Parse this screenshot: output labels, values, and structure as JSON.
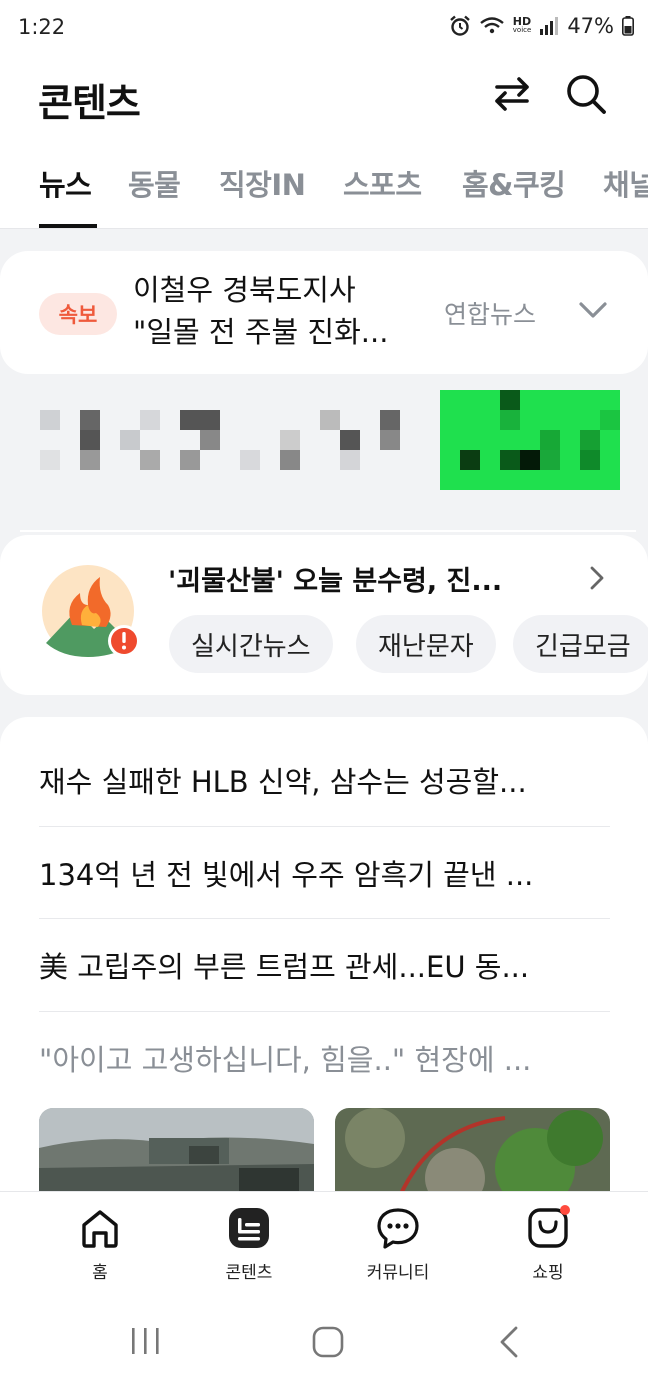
{
  "status_bar": {
    "time": "1:22",
    "hd_label": "HD",
    "voice_label": "voice",
    "battery": "47%"
  },
  "header": {
    "title": "콘텐츠",
    "swap_icon": "swap-arrows-icon",
    "search_icon": "search-icon"
  },
  "tabs": [
    {
      "label": "뉴스",
      "active": true
    },
    {
      "label": "동물",
      "active": false
    },
    {
      "label": "직장IN",
      "active": false
    },
    {
      "label": "스포츠",
      "active": false
    },
    {
      "label": "홈&쿠킹",
      "active": false
    },
    {
      "label": "채널",
      "active": false
    }
  ],
  "breaking": {
    "badge": "속보",
    "title_line1": "이철우 경북도지사",
    "title_line2": "\"일몰 전 주불 진화...",
    "source": "연합뉴스"
  },
  "event_card": {
    "title": "'괴물산불' 오늘 분수령, 진...",
    "chips": [
      "실시간뉴스",
      "재난문자",
      "긴급모금"
    ]
  },
  "news": [
    {
      "title": "재수 실패한 HLB 신약, 삼수는 성공할...",
      "read": false
    },
    {
      "title": "134억 년 전 빛에서 우주 암흑기 끝낸 ...",
      "read": false
    },
    {
      "title": "美 고립주의 부른 트럼프 관세...EU 동...",
      "read": false
    },
    {
      "title": "\"아이고 고생하십니다, 힘을..\" 현장에 ...",
      "read": true
    }
  ],
  "bottom_nav": [
    {
      "label": "홈",
      "icon": "home-icon"
    },
    {
      "label": "콘텐츠",
      "icon": "contents-icon"
    },
    {
      "label": "커뮤니티",
      "icon": "chat-bubble-icon"
    },
    {
      "label": "쇼핑",
      "icon": "shopping-bag-icon"
    }
  ],
  "colors": {
    "accent_red": "#ef5a3c",
    "badge_bg": "#fde7e2",
    "muted_text": "#8a8f96",
    "ad_green": "#1fe04e",
    "notification_dot": "#ff4b3e"
  }
}
